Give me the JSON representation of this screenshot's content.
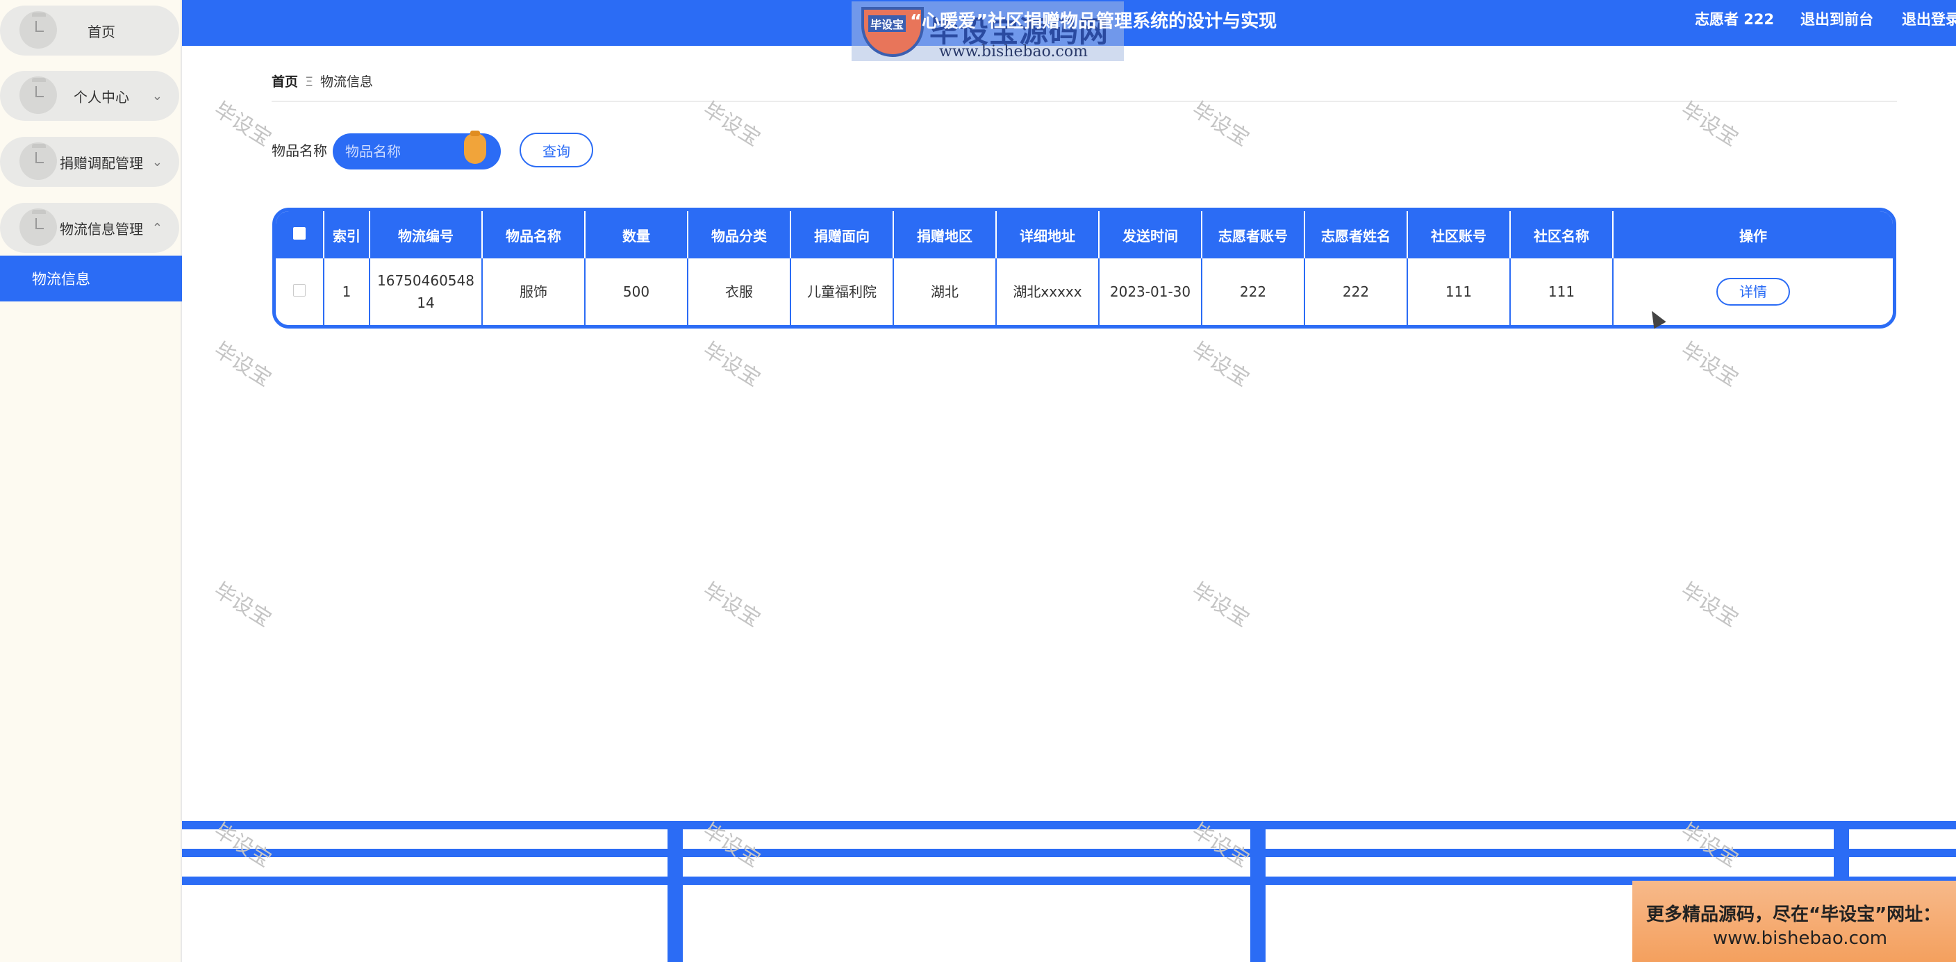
{
  "sidebar": {
    "items": [
      {
        "label": "首页",
        "arrow": ""
      },
      {
        "label": "个人中心",
        "arrow": "⌄"
      },
      {
        "label": "捐赠调配管理",
        "arrow": "⌄"
      },
      {
        "label": "物流信息管理",
        "arrow": "⌃"
      }
    ],
    "sub_item": "物流信息"
  },
  "header": {
    "title": "“心暖爱”社区捐赠物品管理系统的设计与实现",
    "user": "志愿者 222",
    "back_front": "退出到前台",
    "logout": "退出登录"
  },
  "logo": {
    "badge": "毕设宝",
    "name": "毕设宝源码网",
    "url": "www.bishebao.com"
  },
  "breadcrumb": {
    "home": "首页",
    "sep": "Ξ",
    "current": "物流信息"
  },
  "search": {
    "label": "物品名称",
    "placeholder": "物品名称",
    "button": "查询"
  },
  "table": {
    "headers": [
      "索引",
      "物流编号",
      "物品名称",
      "数量",
      "物品分类",
      "捐赠面向",
      "捐赠地区",
      "详细地址",
      "发送时间",
      "志愿者账号",
      "志愿者姓名",
      "社区账号",
      "社区名称",
      "操作"
    ],
    "rows": [
      {
        "index": "1",
        "logistics_no": "1675046054814",
        "item_name": "服饰",
        "quantity": "500",
        "category": "衣服",
        "target": "儿童福利院",
        "region": "湖北",
        "address": "湖北xxxxx",
        "send_time": "2023-01-30",
        "volunteer_account": "222",
        "volunteer_name": "222",
        "community_account": "111",
        "community_name": "111",
        "action": "详情"
      }
    ]
  },
  "watermark": "毕设宝",
  "ad": {
    "line1": "更多精品源码，尽在“毕设宝”网址：",
    "line2": "www.bishebao.com"
  },
  "colors": {
    "primary": "#2b6cf5",
    "sidebar_bg": "#fdfaf1",
    "accent_orange": "#f1a43a"
  }
}
